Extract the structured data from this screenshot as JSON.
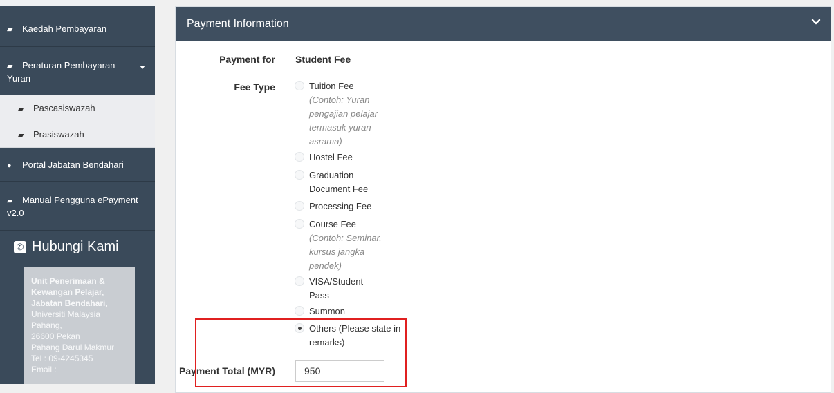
{
  "sidebar": {
    "items": [
      {
        "label": "Kaedah Pembayaran"
      },
      {
        "label": "Peraturan Pembayaran Yuran"
      },
      {
        "label": "Portal Jabatan Bendahari"
      },
      {
        "label": "Manual Pengguna ePayment v2.0"
      }
    ],
    "sub_items": [
      {
        "label": "Pascasiswazah"
      },
      {
        "label": "Prasiswazah"
      }
    ],
    "contact_title": "Hubungi Kami",
    "contact": {
      "org_line1": "Unit Penerimaan &",
      "org_line2": "Kewangan Pelajar,",
      "org_line3": "Jabatan Bendahari,",
      "addr1": "Universiti Malaysia",
      "addr2": "Pahang,",
      "addr3": "26600 Pekan",
      "addr4": "Pahang Darul Makmur",
      "tel": "Tel : 09-4245345",
      "email": "Email :"
    }
  },
  "panel": {
    "title": "Payment Information",
    "payment_for_label": "Payment for",
    "payment_for_value": "Student Fee",
    "fee_type_label": "Fee Type",
    "fee_options": [
      {
        "label": "Tuition Fee",
        "note": "(Contoh: Yuran pengajian pelajar termasuk yuran asrama)",
        "checked": false
      },
      {
        "label": "Hostel Fee",
        "note": "",
        "checked": false
      },
      {
        "label": "Graduation Document Fee",
        "note": "",
        "checked": false
      },
      {
        "label": "Processing Fee",
        "note": "",
        "checked": false
      },
      {
        "label": "Course Fee",
        "note": "(Contoh: Seminar, kursus jangka pendek)",
        "checked": false
      },
      {
        "label": "VISA/Student Pass",
        "note": "",
        "checked": false
      },
      {
        "label": "Summon",
        "note": "",
        "checked": false
      },
      {
        "label": "Others (Please state in remarks)",
        "note": "",
        "checked": true
      }
    ],
    "payment_total_label": "Payment Total (MYR)",
    "payment_total_value": "950"
  },
  "colors": {
    "sidebar_bg": "#3a4a5a",
    "panel_header_bg": "#3f4f60",
    "highlight_border": "#e02020"
  }
}
